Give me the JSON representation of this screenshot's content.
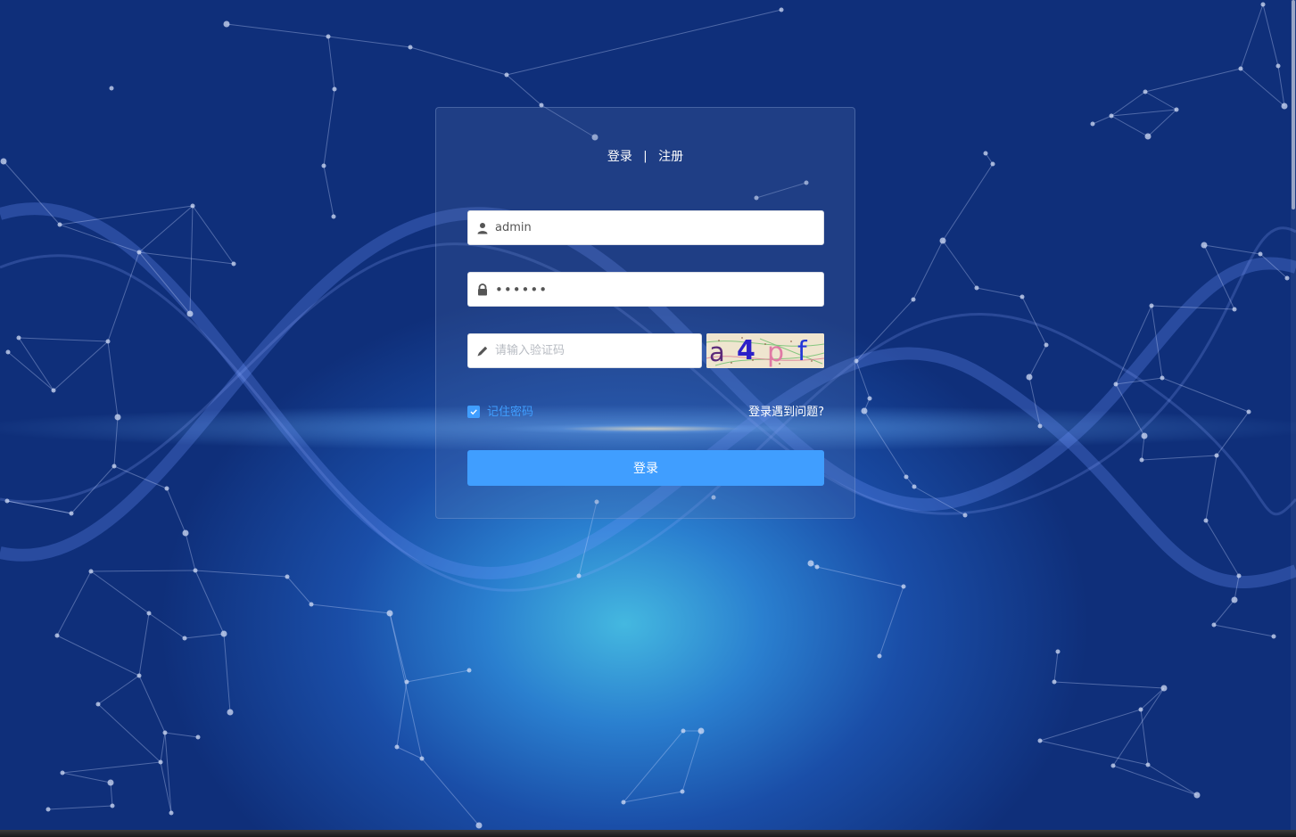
{
  "login_panel": {
    "tabs": {
      "login_label": "登录",
      "separator": "|",
      "register_label": "注册"
    },
    "username": {
      "value": "admin",
      "icon": "user-icon"
    },
    "password": {
      "value": "••••••",
      "icon": "lock-icon"
    },
    "captcha": {
      "value": "",
      "placeholder": "请输入验证码",
      "icon": "pencil-icon",
      "image_text": "a4pf"
    },
    "remember": {
      "label": "记住密码",
      "checked": true
    },
    "help_link_label": "登录遇到问题?",
    "submit_label": "登录"
  },
  "colors": {
    "accent": "#409eff",
    "background_dark": "#0f2f7a",
    "background_glow": "#44b8e0"
  }
}
